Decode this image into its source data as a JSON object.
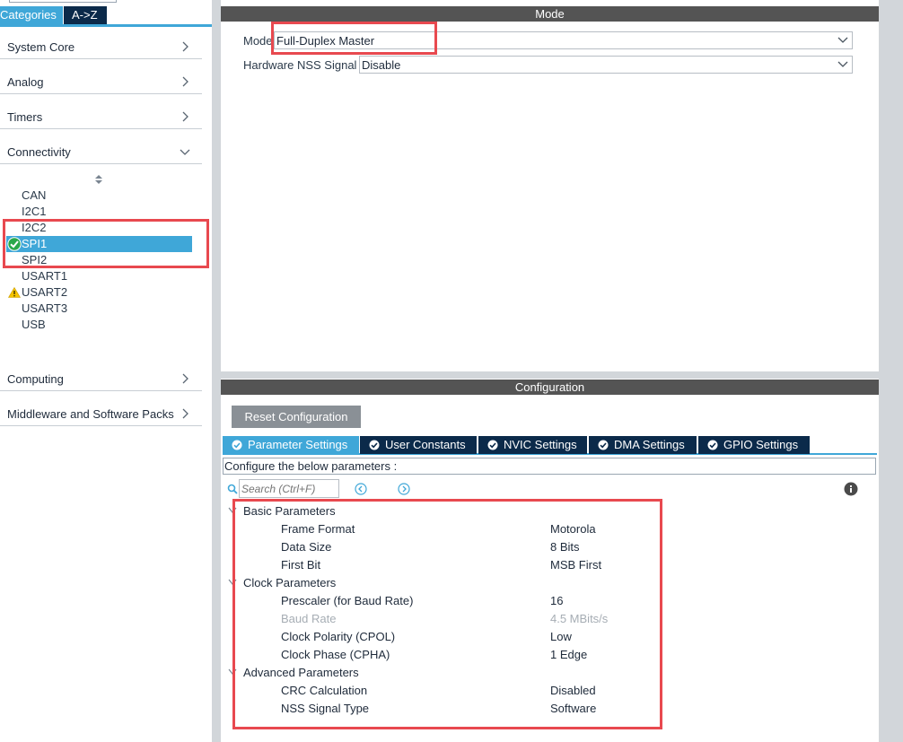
{
  "left_panel": {
    "tabs": {
      "categories": "Categories",
      "az": "A->Z"
    },
    "categories": [
      {
        "label": "System Core",
        "state": "collapsed"
      },
      {
        "label": "Analog",
        "state": "collapsed"
      },
      {
        "label": "Timers",
        "state": "collapsed"
      },
      {
        "label": "Connectivity",
        "state": "expanded"
      },
      {
        "label": "Computing",
        "state": "collapsed"
      },
      {
        "label": "Middleware and Software Packs",
        "state": "collapsed"
      }
    ],
    "connectivity_items": [
      "CAN",
      "I2C1",
      "I2C2",
      "SPI1",
      "SPI2",
      "USART1",
      "USART2",
      "USART3",
      "USB"
    ],
    "selected_item": "SPI1",
    "item_status": {
      "SPI1": "check-icon",
      "USART2": "warning-icon"
    }
  },
  "mode": {
    "header": "Mode",
    "mode_label": "Mode",
    "mode_value": "Full-Duplex Master",
    "nss_label": "Hardware NSS Signal",
    "nss_value": "Disable"
  },
  "configuration": {
    "header": "Configuration",
    "reset_button": "Reset Configuration",
    "tabs": [
      "Parameter Settings",
      "User Constants",
      "NVIC Settings",
      "DMA Settings",
      "GPIO Settings"
    ],
    "active_tab": "Parameter Settings",
    "configure_text": "Configure the below parameters :",
    "search_placeholder": "Search (Ctrl+F)",
    "groups": [
      {
        "name": "Basic Parameters",
        "params": [
          {
            "name": "Frame Format",
            "value": "Motorola"
          },
          {
            "name": "Data Size",
            "value": "8 Bits"
          },
          {
            "name": "First Bit",
            "value": "MSB First"
          }
        ]
      },
      {
        "name": "Clock Parameters",
        "params": [
          {
            "name": "Prescaler (for Baud Rate)",
            "value": "16"
          },
          {
            "name": "Baud Rate",
            "value": "4.5 MBits/s"
          },
          {
            "name": "Clock Polarity (CPOL)",
            "value": "Low"
          },
          {
            "name": "Clock Phase (CPHA)",
            "value": "1 Edge"
          }
        ]
      },
      {
        "name": "Advanced Parameters",
        "params": [
          {
            "name": "CRC Calculation",
            "value": "Disabled"
          },
          {
            "name": "NSS Signal Type",
            "value": "Software"
          }
        ]
      }
    ]
  },
  "colors": {
    "accent": "#3fa7d8",
    "dark_navy": "#0b2a4a",
    "header_gray": "#545454",
    "highlight_red": "#e8494f",
    "check_green": "#2aa84a",
    "warning_yellow": "#f5c400"
  }
}
